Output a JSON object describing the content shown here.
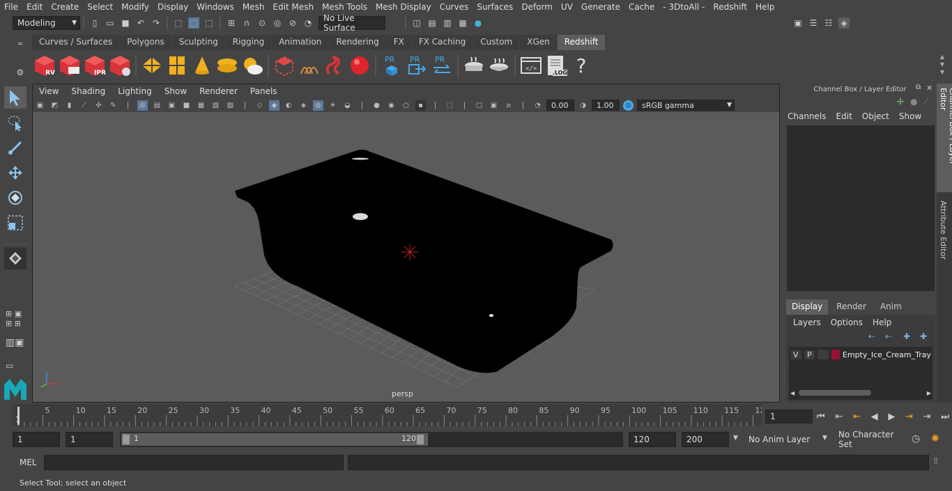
{
  "menubar": [
    "File",
    "Edit",
    "Create",
    "Select",
    "Modify",
    "Display",
    "Windows",
    "Mesh",
    "Edit Mesh",
    "Mesh Tools",
    "Mesh Display",
    "Curves",
    "Surfaces",
    "Deform",
    "UV",
    "Generate",
    "Cache",
    "- 3DtoAll -",
    "Redshift",
    "Help"
  ],
  "statusline": {
    "mode": "Modeling",
    "live_surface": "No Live Surface"
  },
  "shelf_tabs": [
    "Curves / Surfaces",
    "Polygons",
    "Sculpting",
    "Rigging",
    "Animation",
    "Rendering",
    "FX",
    "FX Caching",
    "Custom",
    "XGen",
    "Redshift"
  ],
  "shelf_active": "Redshift",
  "shelf_icons": {
    "rv": "RV",
    "ipr": "IPR",
    "pr": "PR",
    "log": ".LOG",
    "help": "?"
  },
  "viewport": {
    "menu": [
      "View",
      "Shading",
      "Lighting",
      "Show",
      "Renderer",
      "Panels"
    ],
    "exposure": "0.00",
    "gamma": "1.00",
    "colorspace": "sRGB gamma",
    "camera_label": "persp"
  },
  "channel_box": {
    "title": "Channel Box / Layer Editor",
    "menu": [
      "Channels",
      "Edit",
      "Object",
      "Show"
    ]
  },
  "layer_editor": {
    "tabs": [
      "Display",
      "Render",
      "Anim"
    ],
    "active_tab": "Display",
    "menu": [
      "Layers",
      "Options",
      "Help"
    ],
    "layer": {
      "v": "V",
      "p": "P",
      "name": "Empty_Ice_Cream_Tray",
      "color": "#9a1030"
    }
  },
  "side_tabs": [
    "Channel Box / Layer Editor",
    "Attribute Editor"
  ],
  "timeline": {
    "ticks": [
      "5",
      "10",
      "15",
      "20",
      "25",
      "30",
      "35",
      "40",
      "45",
      "50",
      "55",
      "60",
      "65",
      "70",
      "75",
      "80",
      "85",
      "90",
      "95",
      "100",
      "105",
      "110",
      "115",
      "12"
    ],
    "start_label": "1",
    "current_frame": "1"
  },
  "range": {
    "start": "1",
    "playback_start": "1",
    "slider_start": "1",
    "slider_end": "120",
    "playback_end": "120",
    "end": "200",
    "anim_layer": "No Anim Layer",
    "char_set": "No Character Set"
  },
  "cmdline": {
    "label": "MEL"
  },
  "help_line": "Select Tool: select an object"
}
